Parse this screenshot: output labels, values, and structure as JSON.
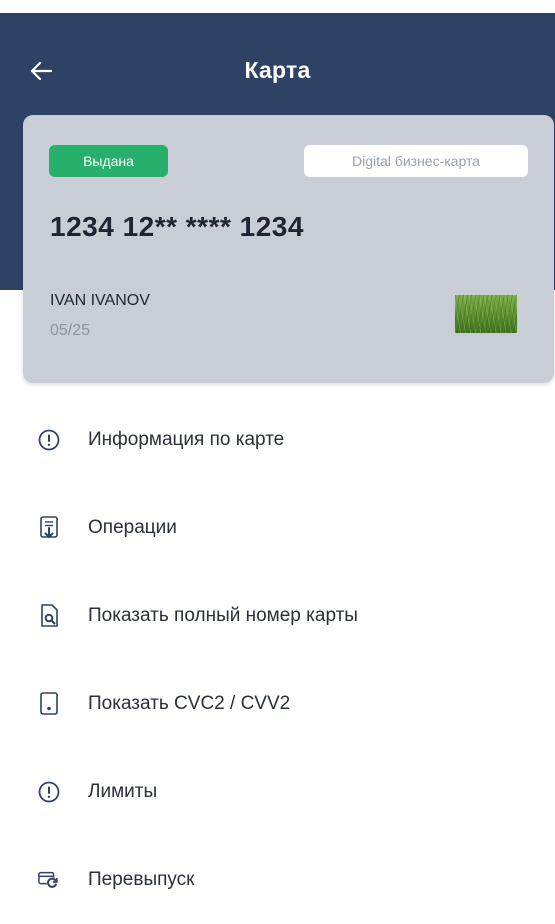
{
  "header": {
    "title": "Карта",
    "background": "#2e4266"
  },
  "card": {
    "status": "Выдана",
    "type": "Digital бизнес-карта",
    "number": "1234 12** **** 1234",
    "holder": "IVAN IVANOV",
    "expiry": "05/25",
    "status_color": "#27b06b",
    "background": "#c9ced6"
  },
  "menu": {
    "items": [
      {
        "label": "Информация по карте",
        "icon": "info-circle-icon"
      },
      {
        "label": "Операции",
        "icon": "document-download-icon"
      },
      {
        "label": "Показать полный номер карты",
        "icon": "document-search-icon"
      },
      {
        "label": "Показать CVC2 / CVV2",
        "icon": "card-device-icon"
      },
      {
        "label": "Лимиты",
        "icon": "info-circle-icon"
      },
      {
        "label": "Перевыпуск",
        "icon": "card-reissue-icon"
      }
    ],
    "icon_color": "#2e4266"
  }
}
